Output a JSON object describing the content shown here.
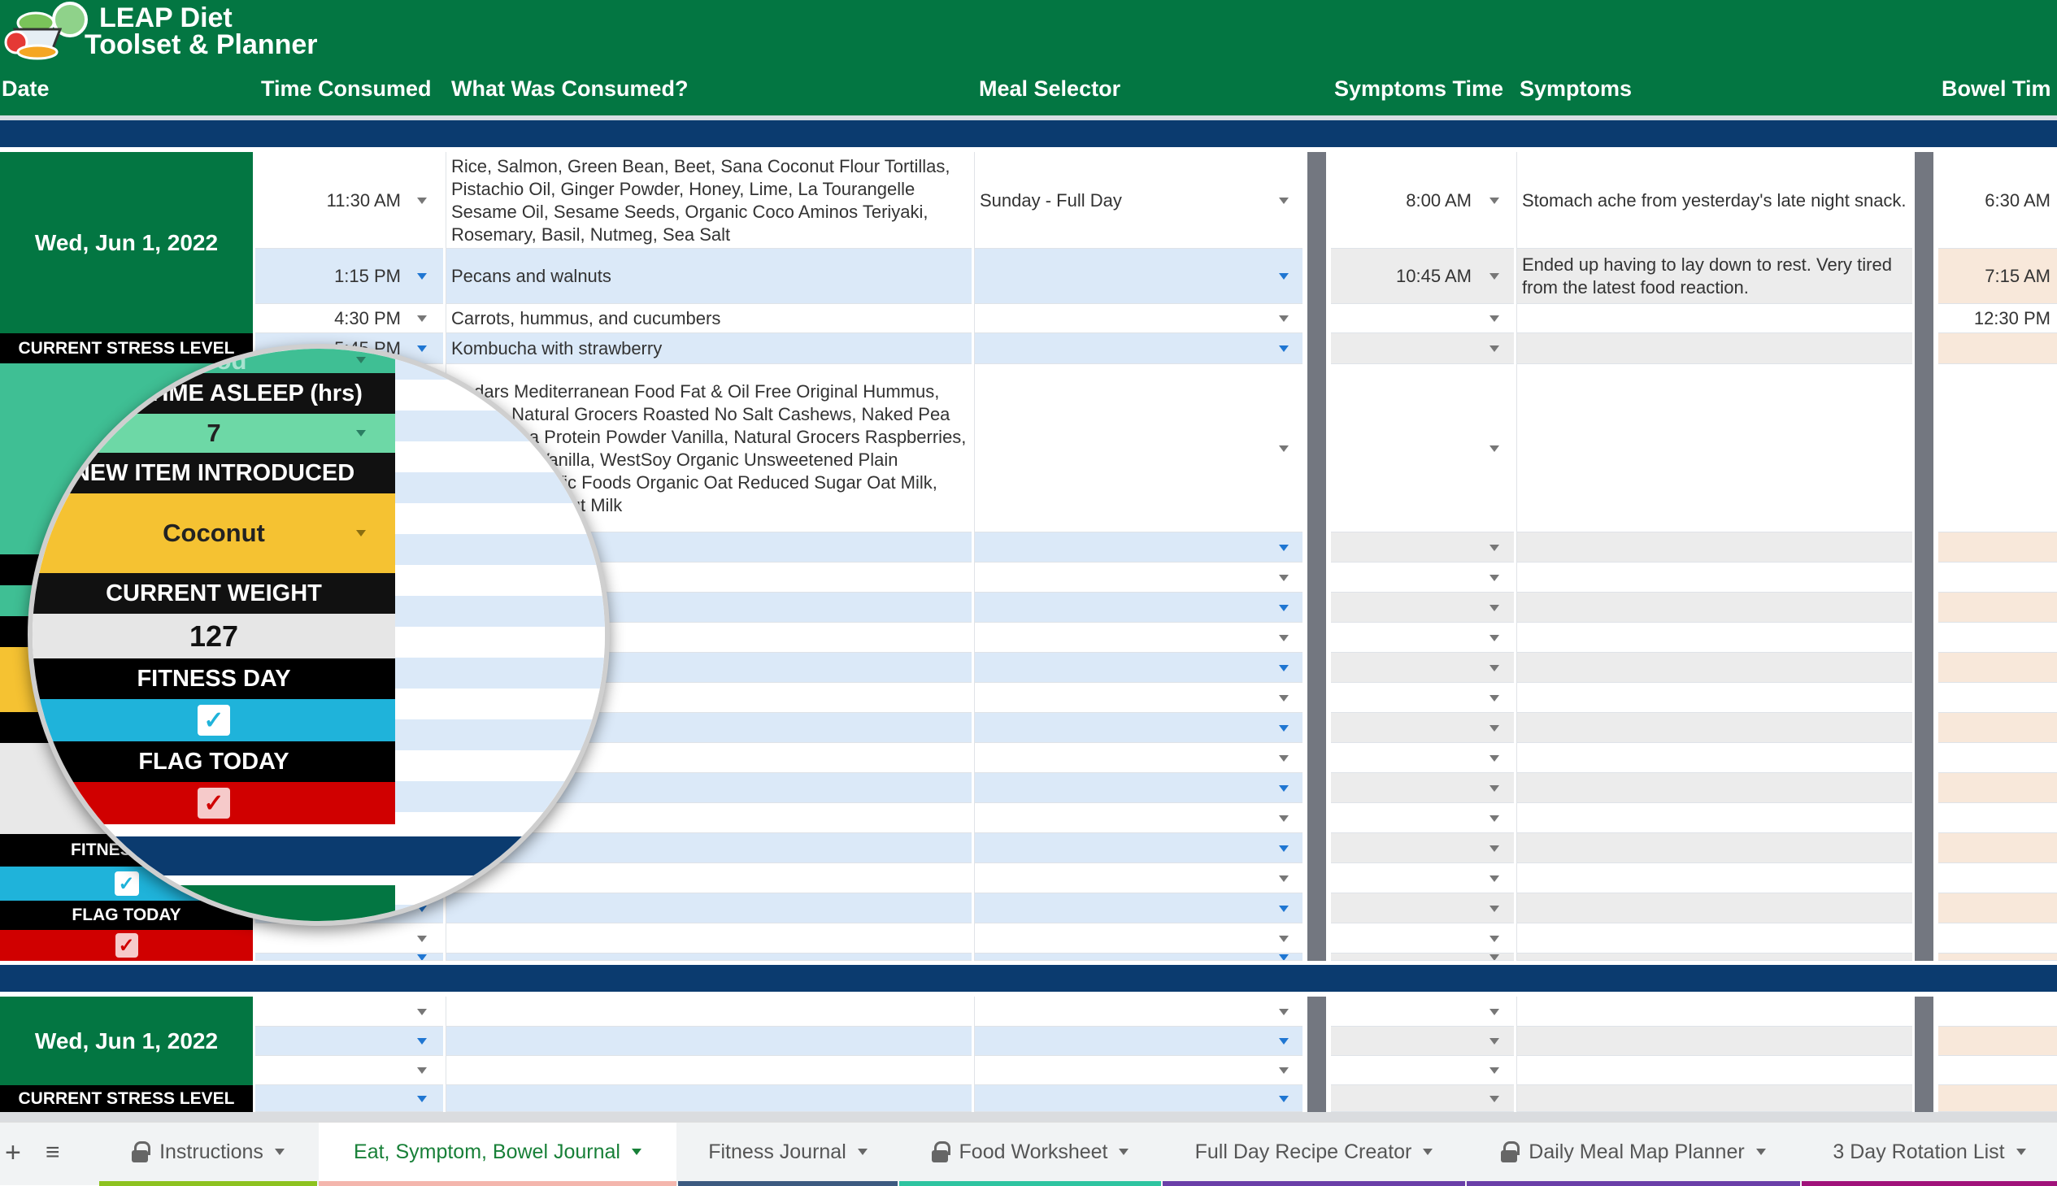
{
  "app": {
    "title_line1": "LEAP Diet",
    "title_line2": "Toolset & Planner",
    "logo_icon": "food-bowl-logo"
  },
  "columns": [
    "Date",
    "Time Consumed",
    "What Was Consumed?",
    "Meal Selector",
    "Symptoms Time",
    "Symptoms",
    "Bowel Tim"
  ],
  "block1": {
    "date": "Wed, Jun 1, 2022",
    "rows": [
      {
        "time": "11:30 AM",
        "what": "Rice, Salmon, Green Bean, Beet, Sana Coconut Flour Tortillas, Pistachio Oil, Ginger Powder, Honey, Lime, La Tourangelle Sesame Oil, Sesame Seeds, Organic Coco Aminos Teriyaki, Rosemary, Basil, Nutmeg, Sea Salt",
        "meal": "Sunday - Full Day",
        "sym_time": "8:00 AM",
        "symptoms": "Stomach ache from yesterday's late night snack.",
        "bowel": "6:30 AM"
      },
      {
        "time": "1:15 PM",
        "what": "Pecans and walnuts",
        "meal": "",
        "sym_time": "10:45 AM",
        "symptoms": "Ended up having to lay down to rest. Very tired from the latest food reaction.",
        "bowel": "7:15 AM"
      },
      {
        "time": "4:30 PM",
        "what": "Carrots, hummus, and cucumbers",
        "meal": "",
        "sym_time": "",
        "symptoms": "",
        "bowel": "12:30 PM"
      },
      {
        "time": "5:45 PM",
        "what": "Kombucha with strawberry",
        "meal": "",
        "sym_time": "",
        "symptoms": "",
        "bowel": ""
      },
      {
        "time": "",
        "what": "Cedars Mediterranean Food Fat & Oil Free Original Hummus, Celery, Natural Grocers Roasted No Salt Cashews, Naked Pea Yellow Pea Protein Powder Vanilla, Natural Grocers Raspberries, Cinnamon Vanilla, WestSoy Organic Unsweetened Plain Soymilk, Pacific Foods Organic Oat Reduced Sugar Oat Milk, Organic Coconut Milk",
        "meal": "",
        "sym_time": "",
        "symptoms": "",
        "bowel": ""
      }
    ],
    "stress_label": "CURRENT STRESS LEVEL",
    "fitness_label": "FITNESS DAY",
    "flag_label": "FLAG TODAY"
  },
  "magnifier": {
    "stress_value": "Good",
    "sleep_label": "TOTAL TIME ASLEEP (hrs)",
    "sleep_value": "7",
    "new_item_label": "NEW ITEM INTRODUCED",
    "new_item_value": "Coconut",
    "weight_label": "CURRENT WEIGHT",
    "weight_value": "127",
    "fitness_label": "FITNESS DAY",
    "fitness_checked": true,
    "flag_label": "FLAG TODAY",
    "flag_checked": true
  },
  "block2": {
    "date": "Wed, Jun 1, 2022",
    "stress_label": "CURRENT STRESS LEVEL"
  },
  "tabs": [
    {
      "label": "Instructions",
      "locked": true,
      "color": "#8dc21f"
    },
    {
      "label": "Eat, Symptom, Bowel Journal",
      "locked": false,
      "active": true,
      "color": "#f4b6ad"
    },
    {
      "label": "Fitness Journal",
      "locked": false,
      "color": "#3d5a80"
    },
    {
      "label": "Food Worksheet",
      "locked": true,
      "color": "#2ec4a0"
    },
    {
      "label": "Full Day Recipe Creator",
      "locked": false,
      "color": "#6a3fa8"
    },
    {
      "label": "Daily Meal Map Planner",
      "locked": true,
      "color": "#6a3fa8"
    },
    {
      "label": "3 Day Rotation List",
      "locked": false,
      "color": "#a0127a"
    }
  ],
  "colors": {
    "header_green": "#037642",
    "band_blue": "#0b3b6f",
    "stress_green": "#3fbf94",
    "new_item_yellow": "#f5c232",
    "fitness_blue": "#1fb3da",
    "flag_red": "#d00000"
  }
}
